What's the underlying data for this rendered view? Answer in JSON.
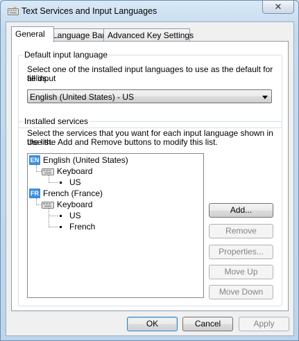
{
  "window": {
    "title": "Text Services and Input Languages",
    "close_label": "✕"
  },
  "tabs": [
    {
      "label": "General",
      "active": true
    },
    {
      "label": "Language Bar",
      "active": false
    },
    {
      "label": "Advanced Key Settings",
      "active": false
    }
  ],
  "default_input": {
    "legend": "Default input language",
    "description_line1": "Select one of the installed input languages to use as the default for all input",
    "description_line2": "fields.",
    "selected": "English (United States) - US"
  },
  "installed_services": {
    "legend": "Installed services",
    "description_line1": "Select the services that you want for each input language shown in the list.",
    "description_line2": "Use the Add and Remove buttons to modify this list.",
    "tree": {
      "languages": [
        {
          "badge": "EN",
          "name": "English (United States)",
          "category": "Keyboard",
          "layouts": [
            "US"
          ]
        },
        {
          "badge": "FR",
          "name": "French (France)",
          "category": "Keyboard",
          "layouts": [
            "US",
            "French"
          ]
        }
      ]
    },
    "buttons": {
      "add": "Add...",
      "remove": "Remove",
      "properties": "Properties...",
      "move_up": "Move Up",
      "move_down": "Move Down"
    }
  },
  "footer": {
    "ok": "OK",
    "cancel": "Cancel",
    "apply": "Apply"
  },
  "colors": {
    "language_badge": "#3b8fdd",
    "selection_highlight": "#3399ff"
  }
}
